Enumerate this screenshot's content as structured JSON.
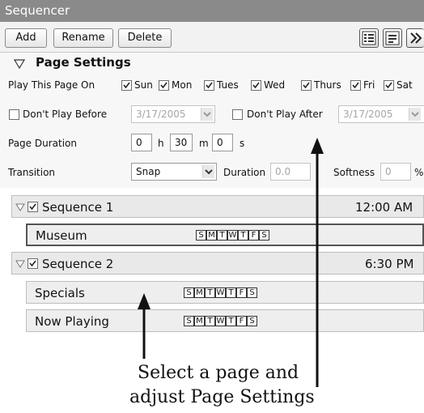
{
  "window": {
    "title": "Sequencer"
  },
  "toolbar": {
    "add_label": "Add",
    "rename_label": "Rename",
    "delete_label": "Delete"
  },
  "page_settings": {
    "header": "Page Settings",
    "play_on_label": "Play This Page On",
    "days": [
      {
        "label": "Sun",
        "checked": true
      },
      {
        "label": "Mon",
        "checked": true
      },
      {
        "label": "Tues",
        "checked": true
      },
      {
        "label": "Wed",
        "checked": true
      },
      {
        "label": "Thurs",
        "checked": true
      },
      {
        "label": "Fri",
        "checked": true
      },
      {
        "label": "Sat",
        "checked": true
      }
    ],
    "dont_play_before_label": "Don't Play Before",
    "dont_play_before_date": "3/17/2005",
    "dont_play_after_label": "Don't Play After",
    "dont_play_after_date": "3/17/2005",
    "duration_label": "Page Duration",
    "hours": "0",
    "hours_unit": "h",
    "minutes": "30",
    "minutes_unit": "m",
    "seconds": "0",
    "seconds_unit": "s",
    "transition_label": "Transition",
    "transition_value": "Snap",
    "trans_duration_label": "Duration",
    "trans_duration_value": "0.0",
    "softness_label": "Softness",
    "softness_value": "0",
    "softness_unit": "%"
  },
  "sequences": [
    {
      "name": "Sequence 1",
      "time": "12:00 AM",
      "checked": true,
      "pages": [
        {
          "name": "Museum",
          "days": [
            "S",
            "M",
            "T",
            "W",
            "T",
            "F",
            "S"
          ]
        }
      ]
    },
    {
      "name": "Sequence 2",
      "time": "6:30 PM",
      "checked": true,
      "pages": [
        {
          "name": "Specials",
          "days": [
            "S",
            "M",
            "T",
            "W",
            "T",
            "F",
            "S"
          ]
        },
        {
          "name": "Now Playing",
          "days": [
            "S",
            "M",
            "T",
            "W",
            "T",
            "F",
            "S"
          ]
        }
      ]
    }
  ],
  "callout": {
    "line1": "Select a page and",
    "line2": "adjust Page Settings"
  }
}
